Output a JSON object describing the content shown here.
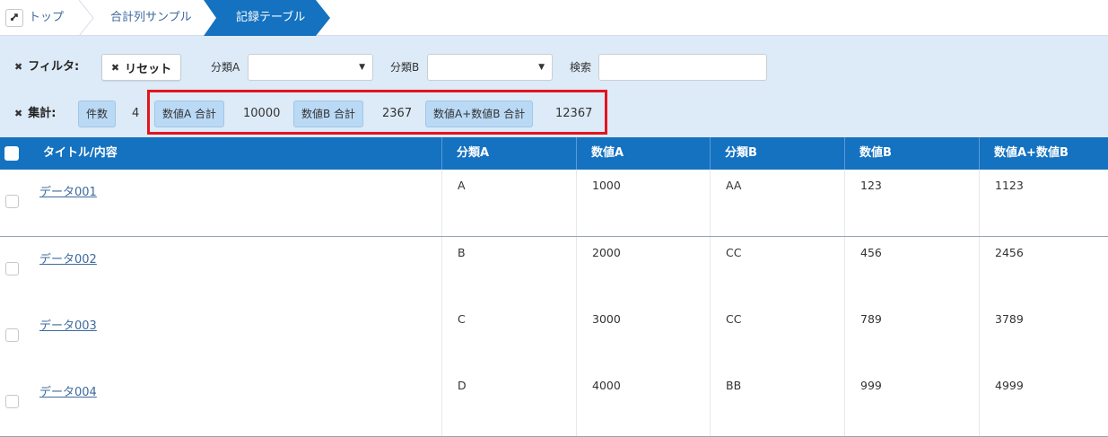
{
  "breadcrumb": {
    "home": "トップ",
    "middle": "合計列サンプル",
    "active": "記録テーブル"
  },
  "filter": {
    "label": "フィルタ:",
    "reset_label": "リセット",
    "categoryA_label": "分類A",
    "categoryA_value": "",
    "categoryB_label": "分類B",
    "categoryB_value": "",
    "search_label": "検索",
    "search_value": ""
  },
  "aggregate": {
    "label": "集計:",
    "count_label": "件数",
    "count_value": "4",
    "sumA_label": "数値A 合計",
    "sumA_value": "10000",
    "sumB_label": "数値B 合計",
    "sumB_value": "2367",
    "sumAB_label": "数値A+数値B 合計",
    "sumAB_value": "12367"
  },
  "table": {
    "columns": [
      "タイトル/内容",
      "分類A",
      "数値A",
      "分類B",
      "数値B",
      "数値A+数値B"
    ],
    "rows": [
      {
        "title": "データ001",
        "catA": "A",
        "numA": "1000",
        "catB": "AA",
        "numB": "123",
        "sum": "1123"
      },
      {
        "title": "データ002",
        "catA": "B",
        "numA": "2000",
        "catB": "CC",
        "numB": "456",
        "sum": "2456"
      },
      {
        "title": "データ003",
        "catA": "C",
        "numA": "3000",
        "catB": "CC",
        "numB": "789",
        "sum": "3789"
      },
      {
        "title": "データ004",
        "catA": "D",
        "numA": "4000",
        "catB": "BB",
        "numB": "999",
        "sum": "4999"
      }
    ]
  },
  "colors": {
    "header_blue": "#1472c0",
    "panel_bg": "#ddeaf7",
    "tag_bg": "#b9d9f5",
    "highlight_red": "#e3141e",
    "link": "#3d6a9e"
  }
}
